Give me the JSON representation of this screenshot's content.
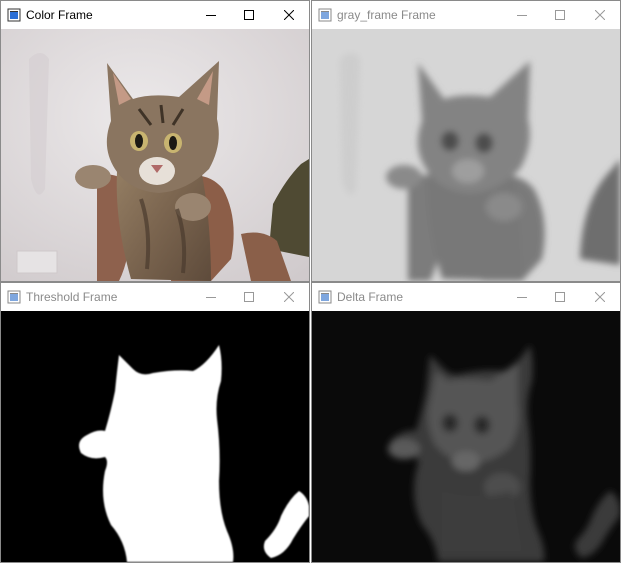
{
  "windows": {
    "color": {
      "title": "Color Frame",
      "active": true,
      "icon": "opencv-window-icon",
      "controls": [
        "minimize-icon",
        "maximize-icon",
        "close-icon"
      ],
      "content": "cat-photo-color"
    },
    "gray": {
      "title": "gray_frame Frame",
      "active": false,
      "icon": "opencv-window-icon",
      "controls": [
        "minimize-icon",
        "maximize-icon",
        "close-icon"
      ],
      "content": "cat-photo-grayscale-blurred"
    },
    "threshold": {
      "title": "Threshold Frame",
      "active": false,
      "icon": "opencv-window-icon",
      "controls": [
        "minimize-icon",
        "maximize-icon",
        "close-icon"
      ],
      "content": "binary-mask-cat-silhouette"
    },
    "delta": {
      "title": "Delta Frame",
      "active": false,
      "icon": "opencv-window-icon",
      "controls": [
        "minimize-icon",
        "maximize-icon",
        "close-icon"
      ],
      "content": "cat-delta-difference"
    }
  },
  "colors": {
    "title_active": "#000000",
    "title_inactive": "#8a8a8a",
    "window_border": "#8a8a8a",
    "threshold_bg": "#000000",
    "threshold_fg": "#ffffff"
  }
}
